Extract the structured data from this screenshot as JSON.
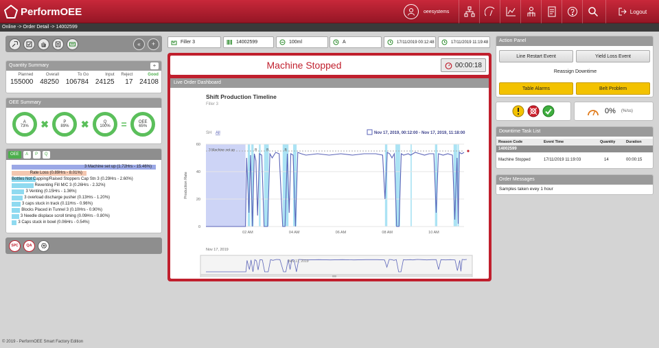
{
  "app": {
    "brand": "PerformOEE",
    "user": "oeesystems",
    "logout_label": "Logout"
  },
  "nav_icons": [
    "hierarchy-icon",
    "gauge-icon",
    "line-chart-icon",
    "operator-icon",
    "report-icon",
    "help-icon",
    "search-icon"
  ],
  "breadcrumb": "Online -> Order Detail -> 14002599",
  "toolbar": {
    "icons": [
      "tool-icon",
      "checklist-icon",
      "hand-icon",
      "document-icon",
      "terminal-icon"
    ]
  },
  "quantity": {
    "title": "Quantity Summary",
    "add_label": "+",
    "columns": [
      {
        "label": "Planned",
        "value": "155000"
      },
      {
        "label": "Overall",
        "value": "48250"
      },
      {
        "label": "To Go",
        "value": "106784"
      },
      {
        "label": "Input",
        "value": "24125"
      },
      {
        "label": "Reject",
        "value": "17"
      },
      {
        "label": "Good",
        "value": "24108"
      }
    ]
  },
  "oee_summary": {
    "title": "OEE Summary",
    "gauges": [
      {
        "label": "A",
        "value": "73%",
        "fraction": 0.73
      },
      {
        "label": "P",
        "value": "89%",
        "fraction": 0.89
      },
      {
        "label": "Q",
        "value": "100%",
        "fraction": 1.0
      },
      {
        "label": "OEE",
        "value": "65%",
        "fraction": 0.65
      }
    ],
    "op_times": "✖",
    "op_equals": "="
  },
  "pareto": {
    "tabs": [
      "OEE",
      "A",
      "P",
      "Q"
    ],
    "items": [
      {
        "label": "3 Machine set up  (1.72Hrs - 15.46%)",
        "pct": 15.46,
        "color": "#9ba8e6"
      },
      {
        "label": "Rate Loss  (0.89Hrs - 8.01%)",
        "pct": 8.01,
        "color": "#f4c7b0"
      },
      {
        "label_a": "Bottles Not",
        "label": "Capping/Raised Stoppers Cap Stn 3  (0.29Hrs - 2.60%)",
        "pct": 2.6,
        "color": "#8fdaf0"
      },
      {
        "label": "Reventing Fill M/C 3  (0.26Hrs - 2.32%)",
        "pct": 2.32,
        "color": "#8fdaf0"
      },
      {
        "label": "3 Venting  (0.15Hrs - 1.36%)",
        "pct": 1.36,
        "color": "#8fdaf0"
      },
      {
        "label": "3 overload discharge pusher  (0.13Hrs - 1.20%)",
        "pct": 1.2,
        "color": "#8fdaf0"
      },
      {
        "label": "3 caps stuck in track  (0.11Hrs - 0.96%)",
        "pct": 0.96,
        "color": "#8fdaf0"
      },
      {
        "label": "Blocks Placed in Tunnel 3  (0.10Hrs - 0.90%)",
        "pct": 0.9,
        "color": "#8fdaf0"
      },
      {
        "label": "3 Needle displace scroll timing  (0.09Hrs - 0.80%)",
        "pct": 0.8,
        "color": "#8fdaf0"
      },
      {
        "label": "3 Caps stuck in bowl  (0.06Hrs - 0.54%)",
        "pct": 0.54,
        "color": "#8fdaf0"
      }
    ]
  },
  "bottom_tools": {
    "spc": "SPC",
    "qa": "QA"
  },
  "info": {
    "machine": "Filler 3",
    "order": "14002599",
    "product": "100ml",
    "shift": "A",
    "start": "17/11/2019 00:12:48",
    "end": "17/11/2019 11:19:48"
  },
  "status": {
    "title": "Machine Stopped",
    "timer": "00:00:18"
  },
  "dashboard": {
    "header": "Live Order Dashboard",
    "title": "Shift Production Timeline",
    "subtitle": "Filler 3",
    "filter_sh": "SH",
    "filter_all": "All",
    "range": "Nov 17, 2019, 00:12:00 - Nov 17, 2019, 11:18:00",
    "navigator_date": "Nov 17, 2019",
    "navigator_mark": "Nov 17, 2019",
    "annotation_setup": "3 Machine set up",
    "annotation_b1": "B",
    "annotation_b2": "B",
    "annotation_b3": "B"
  },
  "chart_data": {
    "type": "line",
    "title": "Shift Production Timeline",
    "subtitle": "Filler 3",
    "xlabel": "",
    "ylabel": "Production Rate",
    "legend": [
      "Production Rate"
    ],
    "ylim": [
      0,
      60
    ],
    "yticks": [
      0,
      20,
      40,
      60
    ],
    "xticks": [
      "02 AM",
      "04 AM",
      "06 AM",
      "08 AM",
      "10 AM"
    ],
    "xlim_hours": [
      0.2,
      11.3
    ],
    "target": 55,
    "series": [
      {
        "name": "Production Rate",
        "x": [
          0.2,
          1.9,
          1.95,
          2.05,
          2.12,
          2.2,
          2.28,
          2.35,
          2.42,
          2.5,
          2.6,
          2.7,
          2.85,
          2.95,
          3.05,
          3.2,
          3.35,
          3.5,
          3.6,
          3.7,
          3.78,
          3.85,
          3.95,
          4.05,
          4.15,
          4.3,
          4.5,
          5,
          5.5,
          6,
          6.5,
          7,
          7.5,
          7.8,
          7.9,
          8,
          8.1,
          8.2,
          8.3,
          8.4,
          8.5,
          8.6,
          8.7,
          8.9,
          9,
          9.1,
          9.2,
          9.4,
          9.6,
          9.8,
          10,
          10.1,
          10.2,
          10.4,
          10.6,
          10.8,
          10.9,
          11,
          11.05,
          11.1,
          11.2,
          11.3
        ],
        "y": [
          0,
          0,
          50,
          10,
          52,
          0,
          53,
          48,
          8,
          53,
          52,
          0,
          0,
          53,
          50,
          54,
          53,
          0,
          0,
          53,
          10,
          53,
          52,
          0,
          54,
          53,
          52,
          53,
          52,
          53,
          52,
          53,
          53,
          52,
          20,
          54,
          53,
          50,
          53,
          0,
          0,
          53,
          52,
          53,
          52,
          53,
          54,
          53,
          52,
          53,
          53,
          10,
          53,
          52,
          53,
          52,
          5,
          50,
          2,
          54,
          53,
          54
        ]
      }
    ],
    "breakdown_bands_hours": [
      [
        2.0,
        2.1
      ],
      [
        2.15,
        2.25
      ],
      [
        2.48,
        2.55
      ],
      [
        2.7,
        2.9
      ],
      [
        3.5,
        3.75
      ],
      [
        3.95,
        4.1
      ],
      [
        7.9,
        8.0
      ],
      [
        8.35,
        8.55
      ],
      [
        9.0,
        9.05
      ],
      [
        10.05,
        10.15
      ],
      [
        10.85,
        11.0
      ],
      [
        11.02,
        11.08
      ]
    ]
  },
  "action_panel": {
    "title": "Action Panel",
    "line_restart": "Line Restart Event",
    "yield_loss": "Yield Loss Event",
    "reassign": "Reassign Downtime",
    "table_alarms": "Table Alarms",
    "belt_problem": "Belt Problem"
  },
  "status_widget": {
    "percent": "0%",
    "unit": "(%/ss)"
  },
  "downtime": {
    "title": "Downtime Task List",
    "columns": [
      "Reason Code",
      "Event Time",
      "Quantity",
      "Duration"
    ],
    "group": "14002599",
    "rows": [
      {
        "reason": "Machine Stopped",
        "time": "17/11/2019 11:19:03",
        "qty": "14",
        "duration": "00:00:15"
      }
    ]
  },
  "messages": {
    "title": "Order Messages",
    "text": "Samples taken evey 1 hour"
  },
  "footer": "© 2019 - PerformOEE Smart Factory Edition",
  "colors": {
    "brand": "#c01f2d",
    "green": "#5bbf5b",
    "series": "#5a63b8",
    "bands": "#8fdaf0",
    "setup": "#c4cdf5"
  }
}
